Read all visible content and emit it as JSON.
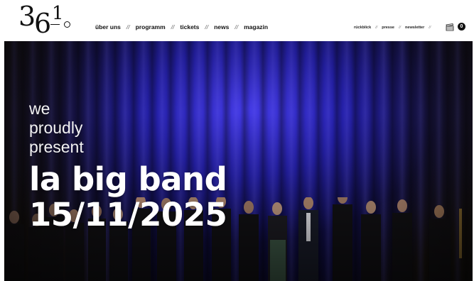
{
  "logo": {
    "text": "361°",
    "digit3": "3",
    "digit6": "6",
    "digit1": "1"
  },
  "main_nav": {
    "items": [
      "über uns",
      "programm",
      "tickets",
      "news",
      "magazin"
    ],
    "separator": "//"
  },
  "secondary_nav": {
    "items": [
      "rückblick",
      "presse",
      "newsletter"
    ],
    "separator": "//"
  },
  "cart": {
    "icon": "ticket-icon",
    "count": "0"
  },
  "hero": {
    "intro_line1": "we",
    "intro_line2": "proudly",
    "intro_line3": "present",
    "title": "la big band",
    "date": "15/11/2025"
  },
  "colors": {
    "accent_blue": "#3a33d8",
    "text_white": "#ffffff",
    "nav_text": "#111111"
  }
}
